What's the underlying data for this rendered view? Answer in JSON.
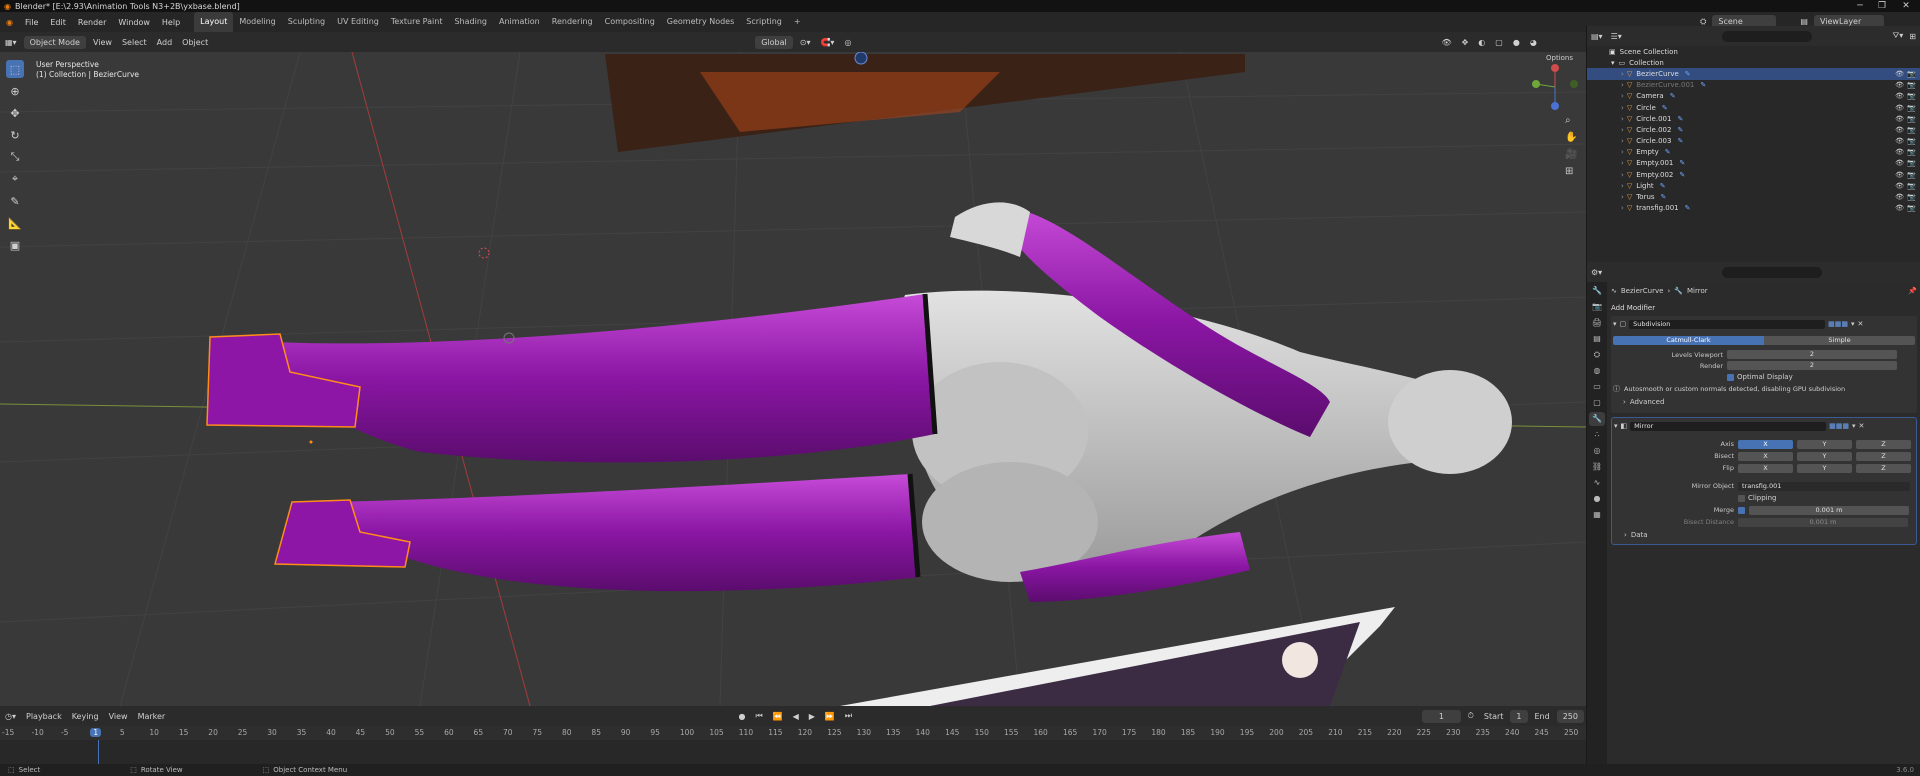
{
  "app": {
    "title": "Blender* [E:\\2.93\\Animation Tools N3+2B\\yxbase.blend]",
    "menu": [
      "File",
      "Edit",
      "Render",
      "Window",
      "Help"
    ],
    "workspaces": [
      "Layout",
      "Modeling",
      "Sculpting",
      "UV Editing",
      "Texture Paint",
      "Shading",
      "Animation",
      "Rendering",
      "Compositing",
      "Geometry Nodes",
      "Scripting"
    ],
    "active_workspace": "Layout",
    "scene": "Scene",
    "view_layer": "ViewLayer",
    "add_workspace": "+"
  },
  "viewport": {
    "mode": "Object Mode",
    "menus": [
      "View",
      "Select",
      "Add",
      "Object"
    ],
    "orientation": "Global",
    "info_line1": "User Perspective",
    "info_line2": "(1) Collection | BezierCurve",
    "options_label": "Options"
  },
  "outliner": {
    "root": "Scene Collection",
    "collection": "Collection",
    "items": [
      {
        "name": "BezierCurve",
        "state": "selected"
      },
      {
        "name": "BezierCurve.001",
        "state": "dim"
      },
      {
        "name": "Camera",
        "state": "normal"
      },
      {
        "name": "Circle",
        "state": "normal"
      },
      {
        "name": "Circle.001",
        "state": "normal"
      },
      {
        "name": "Circle.002",
        "state": "normal"
      },
      {
        "name": "Circle.003",
        "state": "normal"
      },
      {
        "name": "Empty",
        "state": "normal"
      },
      {
        "name": "Empty.001",
        "state": "normal"
      },
      {
        "name": "Empty.002",
        "state": "normal"
      },
      {
        "name": "Light",
        "state": "normal"
      },
      {
        "name": "Torus",
        "state": "normal"
      },
      {
        "name": "transfig.001",
        "state": "normal"
      }
    ]
  },
  "properties": {
    "breadcrumb_object": "BezierCurve",
    "breadcrumb_modifier": "Mirror",
    "add_modifier": "Add Modifier",
    "subdivision": {
      "name": "Subdivision",
      "mode_catmull": "Catmull-Clark",
      "mode_simple": "Simple",
      "levels_label": "Levels Viewport",
      "levels_value": "2",
      "render_label": "Render",
      "render_value": "2",
      "optimal_display": "Optimal Display",
      "warning": "Autosmooth or custom normals detected, disabling GPU subdivision",
      "advanced": "Advanced"
    },
    "mirror": {
      "name": "Mirror",
      "axis_label": "Axis",
      "bisect_label": "Bisect",
      "flip_label": "Flip",
      "x": "X",
      "y": "Y",
      "z": "Z",
      "mirror_object_label": "Mirror Object",
      "mirror_object_value": "transfig.001",
      "clipping": "Clipping",
      "merge_label": "Merge",
      "merge_value": "0.001 m",
      "bisect_distance_label": "Bisect Distance",
      "bisect_distance_value": "0.001 m",
      "data": "Data"
    }
  },
  "timeline": {
    "menus": [
      "Playback",
      "Keying",
      "View",
      "Marker"
    ],
    "current_frame": "1",
    "start_label": "Start",
    "start_value": "1",
    "end_label": "End",
    "end_value": "250",
    "ticks": [
      "-15",
      "-10",
      "-5",
      "1",
      "5",
      "10",
      "15",
      "20",
      "25",
      "30",
      "35",
      "40",
      "45",
      "50",
      "55",
      "60",
      "65",
      "70",
      "75",
      "80",
      "85",
      "90",
      "95",
      "100",
      "105",
      "110",
      "115",
      "120",
      "125",
      "130",
      "135",
      "140",
      "145",
      "150",
      "155",
      "160",
      "165",
      "170",
      "175",
      "180",
      "185",
      "190",
      "195",
      "200",
      "205",
      "210",
      "215",
      "220",
      "225",
      "230",
      "235",
      "240",
      "245",
      "250"
    ]
  },
  "status": {
    "select": "Select",
    "rotate": "Rotate View",
    "context": "Object Context Menu",
    "version": "3.6.0"
  },
  "colors": {
    "accent": "#4772b3",
    "selection": "#ff8c1a",
    "boots": "#9b1fb0",
    "body": "#c9c9c9"
  }
}
